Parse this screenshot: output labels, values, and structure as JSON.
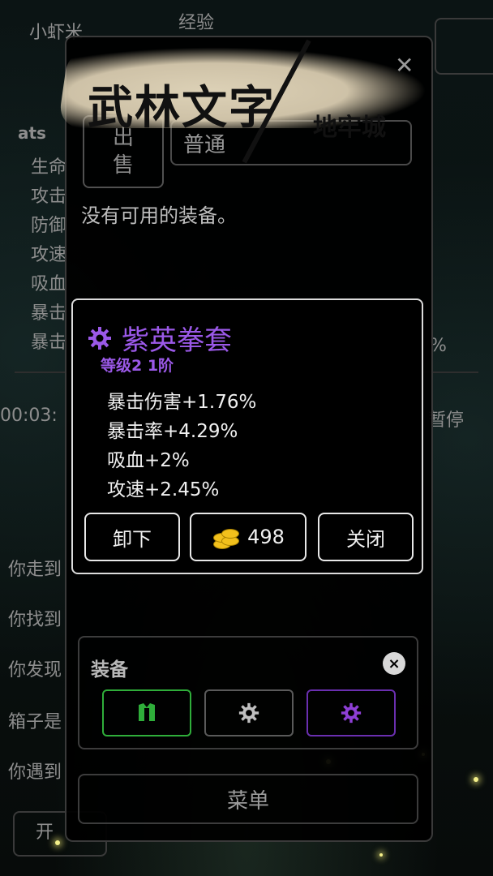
{
  "background": {
    "top_left": [
      "小虾米",
      "经验"
    ],
    "stats_label": "ats",
    "stat_labels": [
      "生命",
      "攻击",
      "防御",
      "攻速",
      "吸血",
      "暴击",
      "暴击"
    ],
    "right_pct": "%",
    "time": "00:03:",
    "pause": "暂停",
    "log_lines": [
      "你走到",
      "你找到",
      "你发现",
      "箱子是",
      "你遇到"
    ],
    "bottom_btn": "开"
  },
  "logo": {
    "main": "武林文字",
    "sub": "地牢城"
  },
  "inventory": {
    "sell_label": "出\n售",
    "filter_value": "普通",
    "empty_message": "没有可用的装备。"
  },
  "item": {
    "name": "紫英拳套",
    "level": "等级2 1阶",
    "stats": [
      "暴击伤害+1.76%",
      "暴击率+4.29%",
      "吸血+2%",
      "攻速+2.45%"
    ],
    "unequip_label": "卸下",
    "price": "498",
    "close_label": "关闭",
    "color": "#9b59e8"
  },
  "equipment": {
    "title": "装备",
    "slots": [
      {
        "icon": "armor-icon",
        "color": "#2fae3a"
      },
      {
        "icon": "gear-icon",
        "color": "#bfbfbf"
      },
      {
        "icon": "gear-icon",
        "color": "#8e3fd6"
      }
    ]
  },
  "menu_label": "菜单"
}
